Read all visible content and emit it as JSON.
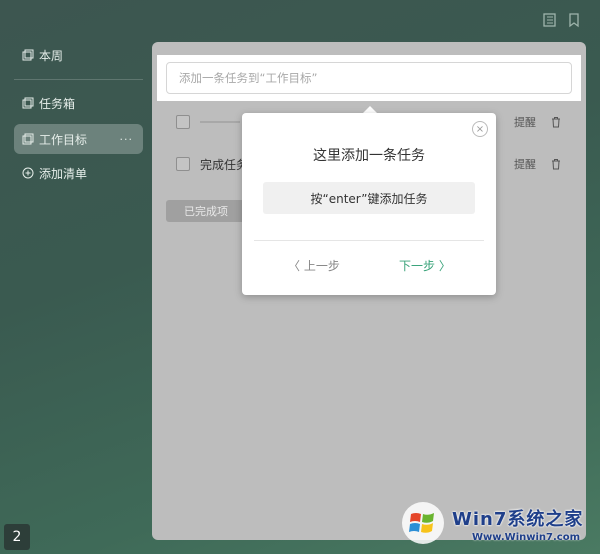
{
  "sidebar": {
    "items": [
      {
        "label": "本周",
        "icon": "copy-icon"
      },
      {
        "label": "任务箱",
        "icon": "copy-icon"
      },
      {
        "label": "工作目标",
        "icon": "copy-icon",
        "active": true,
        "more": "···"
      },
      {
        "label": "添加清单",
        "icon": "plus-circle-icon"
      }
    ]
  },
  "main": {
    "input": {
      "placeholder": "添加一条任务到“工作目标”"
    },
    "tasks": [
      {
        "label": "",
        "remind_label": "提醒"
      },
      {
        "label": "完成任务",
        "remind_label": "提醒"
      }
    ],
    "completed_label": "已完成项"
  },
  "popup": {
    "title": "这里添加一条任务",
    "hint": "按“enter”键添加任务",
    "prev_label": "〈 上一步",
    "next_label": "下一步 〉",
    "close_glyph": "×"
  },
  "badge": {
    "number": "2"
  },
  "watermark": {
    "brand": "Win7系统之家",
    "url": "Www.Winwin7.com"
  },
  "colors": {
    "accent_green": "#3aa37a",
    "bg_green": "#3d5c52"
  }
}
